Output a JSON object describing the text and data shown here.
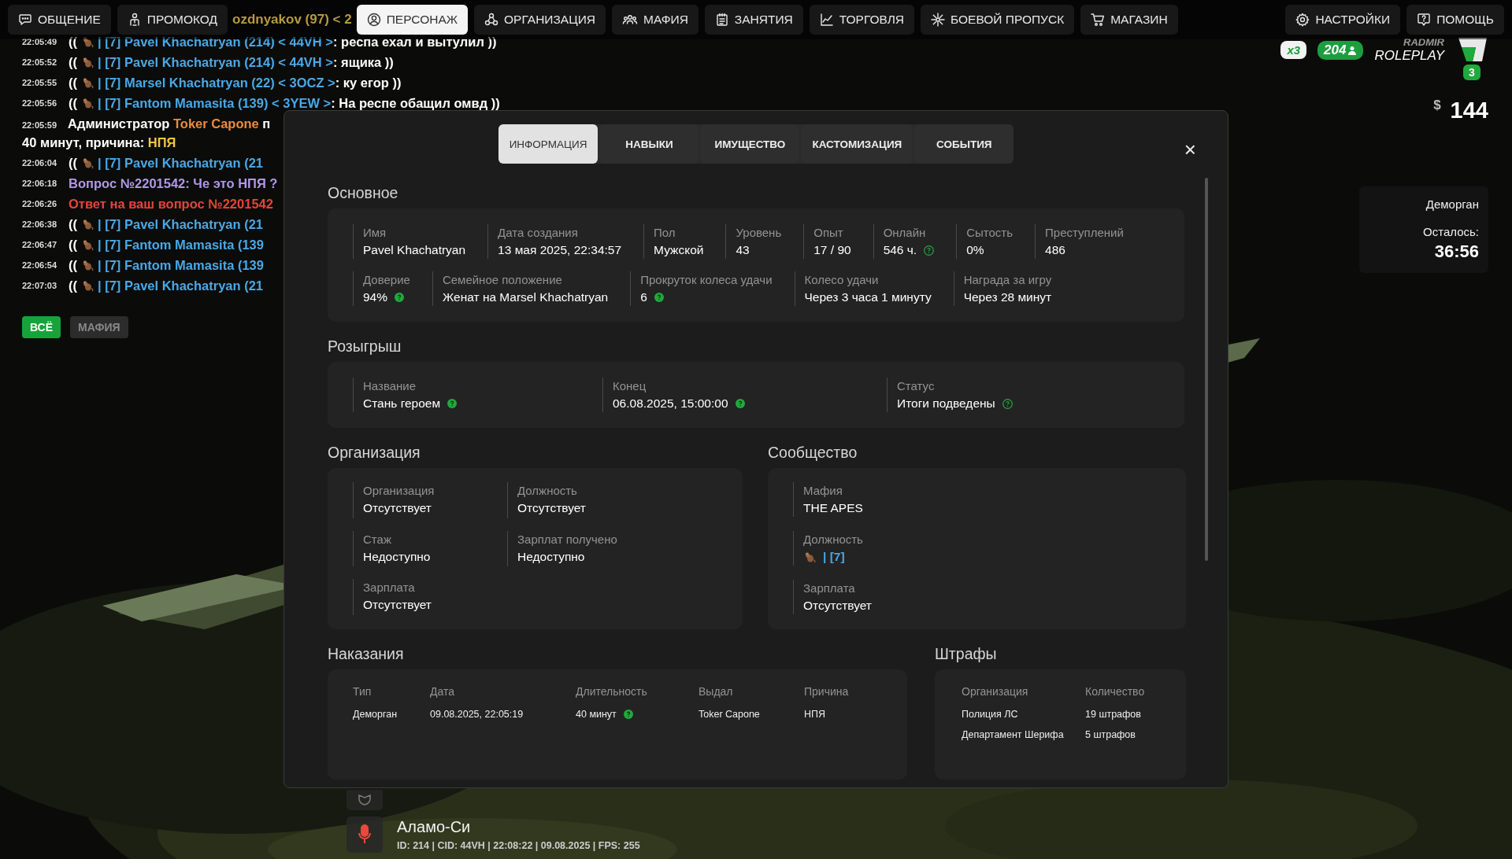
{
  "top_nav": {
    "left": [
      {
        "label": "ОБЩЕНИЕ",
        "kind": "chat",
        "selected": false
      },
      {
        "label": "ПРОМОКОД",
        "kind": "person",
        "selected": false
      },
      {
        "label": "ПЕРСОНАЖ",
        "kind": "user",
        "selected": true
      },
      {
        "label": "ОРГАНИЗАЦИЯ",
        "kind": "network",
        "selected": false
      },
      {
        "label": "МАФИЯ",
        "kind": "group",
        "selected": false
      },
      {
        "label": "ЗАНЯТИЯ",
        "kind": "notepad",
        "selected": false
      },
      {
        "label": "ТОРГОВЛЯ",
        "kind": "chart",
        "selected": false
      },
      {
        "label": "БОЕВОЙ ПРОПУСК",
        "kind": "snowflake",
        "selected": false
      },
      {
        "label": "МАГАЗИН",
        "kind": "cart",
        "selected": false
      }
    ],
    "right": [
      {
        "label": "НАСТРОЙКИ",
        "kind": "gear",
        "selected": false
      },
      {
        "label": "ПОМОЩЬ",
        "kind": "help",
        "selected": false
      }
    ],
    "hidden_chat_text": "ozdnyakov (97) < 2"
  },
  "chat": {
    "lines": [
      {
        "time": "22:05:49",
        "kind": "player",
        "prefix": "((",
        "name": "| [7] Pavel Khachatryan (214) < 44VH >",
        "text": ": респа ехал и вытулил ))"
      },
      {
        "time": "22:05:52",
        "kind": "player",
        "prefix": "((",
        "name": "| [7] Pavel Khachatryan (214) < 44VH >",
        "text": ": ящика ))"
      },
      {
        "time": "22:05:55",
        "kind": "player",
        "prefix": "((",
        "name": "| [7] Marsel Khachatryan (22) < 3OCZ >",
        "text": ": ку егор ))"
      },
      {
        "time": "22:05:56",
        "kind": "player",
        "prefix": "((",
        "name": "| [7] Fantom Mamasita (139) < 3YEW >",
        "text": ": На респе обащил омвд ))"
      },
      {
        "time": "22:05:59",
        "kind": "admin",
        "role": "Администратор",
        "name": "Toker Capone",
        "text": "п",
        "line2": "40 минут, причина:",
        "reason": "НПЯ"
      },
      {
        "time": "22:06:04",
        "kind": "player",
        "prefix": "((",
        "name": "| [7] Pavel Khachatryan (21"
      },
      {
        "time": "22:06:18",
        "kind": "question",
        "text": "Вопрос №2201542: Че это НПЯ ?"
      },
      {
        "time": "22:06:26",
        "kind": "answer",
        "text": "Ответ на ваш вопрос №2201542"
      },
      {
        "time": "22:06:38",
        "kind": "player",
        "prefix": "((",
        "name": "| [7] Pavel Khachatryan (21"
      },
      {
        "time": "22:06:47",
        "kind": "player",
        "prefix": "((",
        "name": "| [7] Fantom Mamasita (139"
      },
      {
        "time": "22:06:54",
        "kind": "player",
        "prefix": "((",
        "name": "| [7] Fantom Mamasita (139"
      },
      {
        "time": "22:07:03",
        "kind": "player",
        "prefix": "((",
        "name": "| [7] Pavel Khachatryan (21"
      }
    ],
    "filters": [
      {
        "label": "ВСЁ",
        "selected": true
      },
      {
        "label": "МАФИЯ",
        "selected": false
      }
    ]
  },
  "hud": {
    "multiplier": "x3",
    "online": "204",
    "logo_top": "RADMIR",
    "logo_bottom": "ROLEPLAY",
    "logo_badge": "3",
    "currency": "$",
    "money": "144",
    "status": {
      "title": "Деморган",
      "label": "Осталось:",
      "timer": "36:56"
    }
  },
  "location": {
    "name": "Аламо-Си",
    "info": "ID: 214 | CID: 44VH | 22:08:22 | 09.08.2025 | FPS: 255"
  },
  "character_modal": {
    "close": "×",
    "tabs": [
      {
        "label": "ИНФОРМАЦИЯ",
        "selected": true
      },
      {
        "label": "НАВЫКИ",
        "selected": false
      },
      {
        "label": "ИМУЩЕСТВО",
        "selected": false
      },
      {
        "label": "КАСТОМИЗАЦИЯ",
        "selected": false
      },
      {
        "label": "СОБЫТИЯ",
        "selected": false
      }
    ],
    "main": {
      "title": "Основное",
      "lines": [
        {
          "fields": [
            {
              "label": "Имя",
              "value": "Pavel Khachatryan"
            },
            {
              "label": "Дата создания",
              "value": "13 мая 2025, 22:34:57"
            },
            {
              "label": "Пол",
              "value": "Мужской"
            },
            {
              "label": "Уровень",
              "value": "43"
            },
            {
              "label": "Опыт",
              "value": "17 / 90"
            },
            {
              "label": "Онлайн",
              "value": "546 ч.",
              "help": true,
              "outlined": true
            },
            {
              "label": "Сытость",
              "value": "0%"
            },
            {
              "label": "Преступлений",
              "value": "486"
            }
          ]
        },
        {
          "fields": [
            {
              "label": "Доверие",
              "value": "94%",
              "help": true,
              "outlined": false
            },
            {
              "label": "Семейное положение",
              "value": "Женат на Marsel Khachatryan"
            },
            {
              "label": "Прокруток колеса удачи",
              "value": "6",
              "help": true,
              "outlined": false
            },
            {
              "label": "Колесо удачи",
              "value": "Через 3 часа 1 минуту"
            },
            {
              "label": "Награда за игру",
              "value": "Через 28 минут"
            }
          ]
        }
      ]
    },
    "raffle": {
      "title": "Розыгрыш",
      "fields": [
        {
          "label": "Название",
          "value": "Стань героем",
          "help": true,
          "outlined": false
        },
        {
          "label": "Конец",
          "value": "06.08.2025, 15:00:00",
          "help": true,
          "outlined": false
        },
        {
          "label": "Статус",
          "value": "Итоги подведены",
          "help": true,
          "outlined": true
        }
      ]
    },
    "organization": {
      "title": "Организация",
      "fields": [
        {
          "label": "Организация",
          "value": "Отсутствует"
        },
        {
          "label": "Должность",
          "value": "Отсутствует"
        },
        {
          "label": "Стаж",
          "value": "Недоступно"
        },
        {
          "label": "Зарплат получено",
          "value": "Недоступно"
        },
        {
          "label": "Зарплата",
          "value": "Отсутствует"
        }
      ]
    },
    "community": {
      "title": "Сообщество",
      "fields": [
        {
          "label": "Мафия",
          "value": "THE APES"
        },
        {
          "label": "Должность",
          "value": "| [7]",
          "kind": "rank"
        },
        {
          "label": "Зарплата",
          "value": "Отсутствует"
        }
      ]
    },
    "punishments": {
      "title": "Наказания",
      "columns": [
        "Тип",
        "Дата",
        "Длительность",
        "Выдал",
        "Причина"
      ],
      "rows": [
        [
          {
            "text": "Деморган"
          },
          {
            "text": "09.08.2025, 22:05:19"
          },
          {
            "text": "40 минут",
            "help": true,
            "outlined": false
          },
          {
            "text": "Toker Capone"
          },
          {
            "text": "НПЯ"
          }
        ]
      ]
    },
    "fines": {
      "title": "Штрафы",
      "columns": [
        "Организация",
        "Количество"
      ],
      "rows": [
        [
          {
            "text": "Полиция ЛС"
          },
          {
            "text": "19 штрафов"
          }
        ],
        [
          {
            "text": "Департамент Шерифа"
          },
          {
            "text": "5 штрафов"
          }
        ]
      ]
    }
  }
}
